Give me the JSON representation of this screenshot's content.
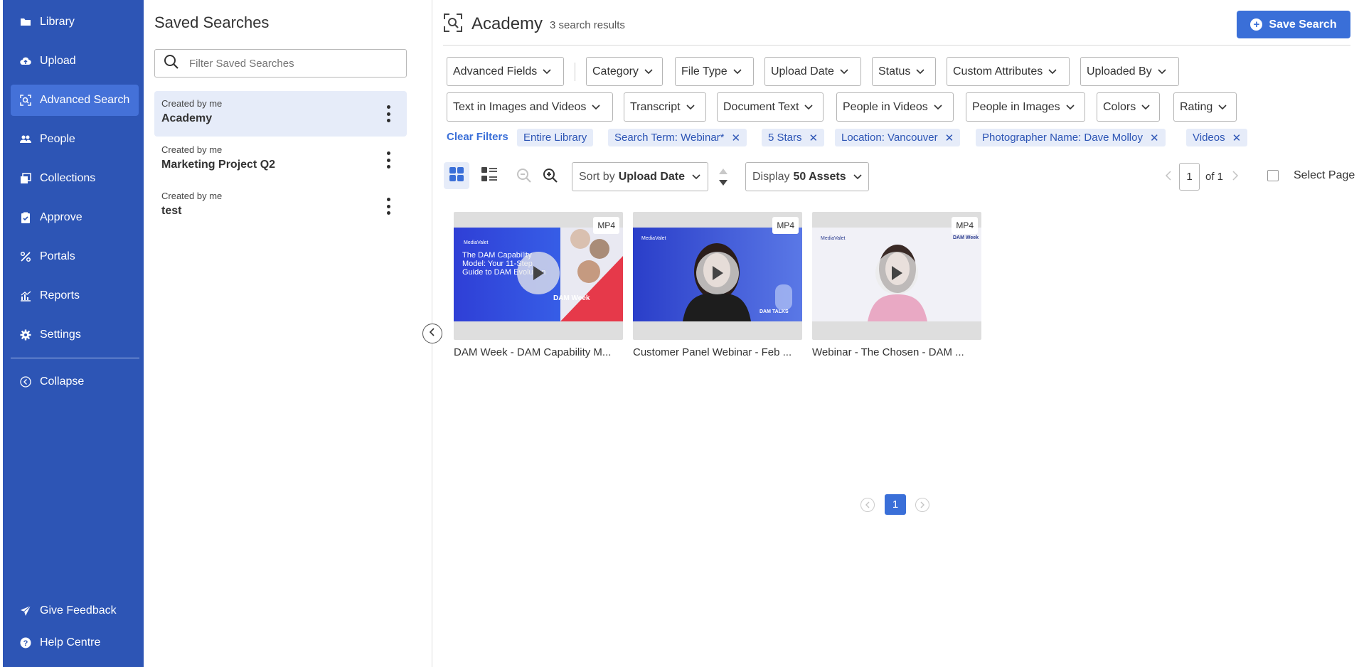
{
  "sidebar": {
    "items": [
      {
        "label": "Library",
        "icon": "folder-icon"
      },
      {
        "label": "Upload",
        "icon": "cloud-upload-icon"
      },
      {
        "label": "Advanced Search",
        "icon": "search-scan-icon"
      },
      {
        "label": "People",
        "icon": "people-icon"
      },
      {
        "label": "Collections",
        "icon": "collections-icon"
      },
      {
        "label": "Approve",
        "icon": "clipboard-check-icon"
      },
      {
        "label": "Portals",
        "icon": "portals-icon"
      },
      {
        "label": "Reports",
        "icon": "chart-icon"
      },
      {
        "label": "Settings",
        "icon": "gear-icon"
      }
    ],
    "collapse_label": "Collapse",
    "feedback_label": "Give Feedback",
    "help_label": "Help Centre",
    "accent": "#2d55b5",
    "active_bg": "#4471d8"
  },
  "saved": {
    "title": "Saved Searches",
    "filter_placeholder": "Filter Saved Searches",
    "items": [
      {
        "meta": "Created by me",
        "name": "Academy"
      },
      {
        "meta": "Created by me",
        "name": "Marketing Project Q2"
      },
      {
        "meta": "Created by me",
        "name": "test"
      }
    ]
  },
  "main": {
    "title": "Academy",
    "result_count": "3 search results",
    "save_button": "Save Search",
    "filters_row1": [
      "Advanced Fields",
      "Category",
      "File Type",
      "Upload Date",
      "Status",
      "Custom Attributes",
      "Uploaded By"
    ],
    "filters_row2": [
      "Text in Images and Videos",
      "Transcript",
      "Document Text",
      "People in Videos",
      "People in Images",
      "Colors",
      "Rating"
    ],
    "clear_filters": "Clear Filters",
    "chips": [
      "Entire Library",
      "Search Term: Webinar*",
      "5 Stars",
      "Location: Vancouver",
      "Photographer Name: Dave Molloy",
      "Videos"
    ],
    "sort_prefix": "Sort by",
    "sort_value": "Upload Date",
    "display_prefix": "Display",
    "display_value": "50 Assets",
    "page_current": "1",
    "page_of": "of 1",
    "select_page": "Select Page",
    "cards": [
      {
        "title": "DAM Week - DAM Capability M...",
        "badge": "MP4",
        "thumb_brand": "MediaValet",
        "thumb_text": "The DAM Capability Model: Your 11-Step Guide to DAM Evolution",
        "thumb_logo": "DAM Week"
      },
      {
        "title": "Customer Panel Webinar - Feb ...",
        "badge": "MP4",
        "thumb_brand": "MediaValet",
        "thumb_logo": "DAM TALKS"
      },
      {
        "title": "Webinar - The Chosen - DAM ...",
        "badge": "MP4",
        "thumb_brand": "MediaValet",
        "thumb_logo": "DAM Week"
      }
    ],
    "bottom_page": "1"
  }
}
